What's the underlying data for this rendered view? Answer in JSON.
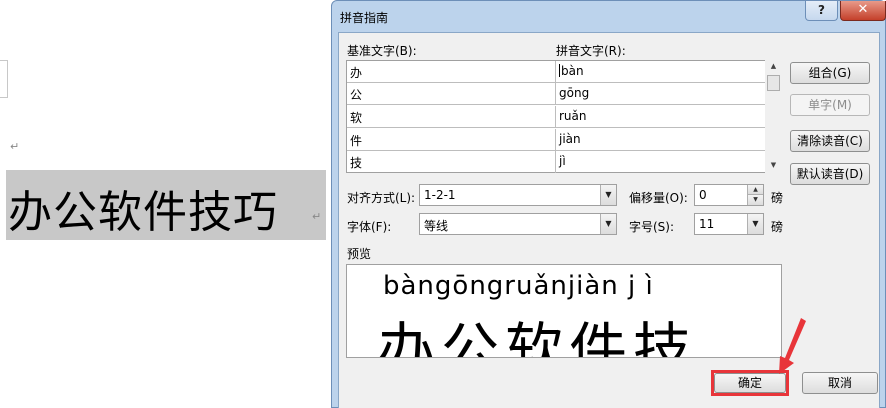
{
  "document": {
    "text": "办公软件技巧",
    "para_mark": "↵"
  },
  "dialog": {
    "title": "拼音指南",
    "help": "?",
    "close": "✕",
    "base_label": "基准文字(B):",
    "ruby_label": "拼音文字(R):",
    "rows": [
      {
        "base": "办",
        "ruby": "bàn"
      },
      {
        "base": "公",
        "ruby": "gōng"
      },
      {
        "base": "软",
        "ruby": "ruǎn"
      },
      {
        "base": "件",
        "ruby": "jiàn"
      },
      {
        "base": "技",
        "ruby": "jì"
      }
    ],
    "buttons": {
      "group": "组合(G)",
      "mono": "单字(M)",
      "clear": "清除读音(C)",
      "default": "默认读音(D)",
      "ok": "确定",
      "cancel": "取消"
    },
    "align_label": "对齐方式(L):",
    "align_value": "1-2-1",
    "offset_label": "偏移量(O):",
    "offset_value": "0",
    "offset_unit": "磅",
    "font_label": "字体(F):",
    "font_value": "等线",
    "size_label": "字号(S):",
    "size_value": "11",
    "size_unit": "磅",
    "preview_label": "预览",
    "preview_ruby": "bàngōngruǎnjiàn j ì",
    "preview_base": "办公软件技"
  },
  "colors": {
    "highlight": "#e8353a",
    "selection": "#c8c8c8"
  }
}
